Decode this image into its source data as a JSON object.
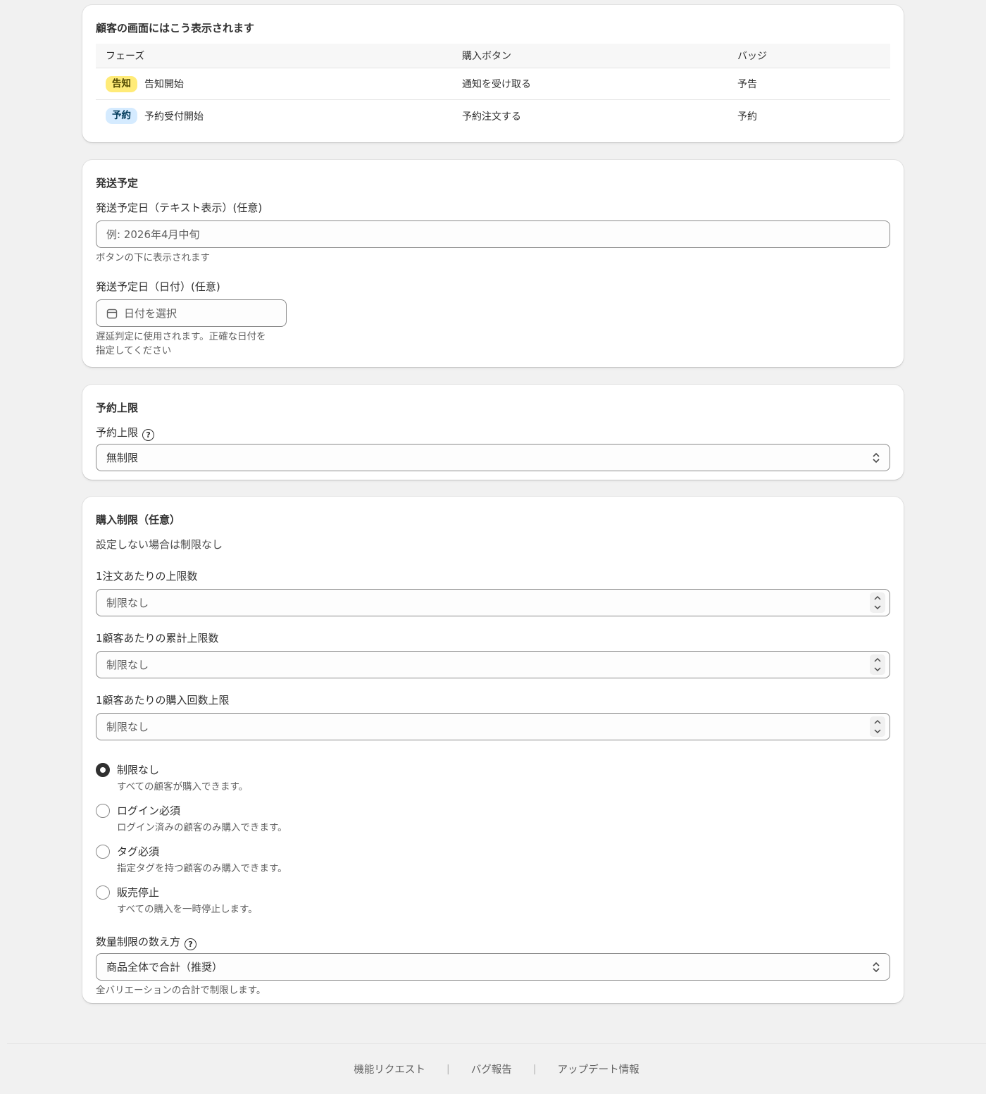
{
  "preview": {
    "title": "顧客の画面にはこう表示されます",
    "columns": [
      "フェーズ",
      "購入ボタン",
      "バッジ"
    ],
    "rows": [
      {
        "badge": "告知",
        "phase": "告知開始",
        "button": "通知を受け取る",
        "badge_text": "予告",
        "badge_color": "#ffeb78"
      },
      {
        "badge": "予約",
        "phase": "予約受付開始",
        "button": "予約注文する",
        "badge_text": "予約",
        "badge_color": "#d5ebff"
      }
    ]
  },
  "shipping": {
    "title": "発送予定",
    "text_label": "発送予定日（テキスト表示）(任意)",
    "text_placeholder": "例: 2026年4月中旬",
    "text_help": "ボタンの下に表示されます",
    "date_label": "発送予定日（日付）(任意)",
    "date_placeholder": "日付を選択",
    "date_help_line1": "遅延判定に使用されます。正確な日付を",
    "date_help_line2": "指定してください"
  },
  "limit": {
    "title": "予約上限",
    "label": "予約上限",
    "value": "無制限"
  },
  "purchase": {
    "title": "購入制限（任意）",
    "subtitle": "設定しない場合は制限なし",
    "per_order_label": "1注文あたりの上限数",
    "per_order_placeholder": "制限なし",
    "per_customer_label": "1顧客あたりの累計上限数",
    "per_customer_placeholder": "制限なし",
    "times_label": "1顧客あたりの購入回数上限",
    "times_placeholder": "制限なし",
    "radios": [
      {
        "label": "制限なし",
        "help": "すべての顧客が購入できます。",
        "checked": true
      },
      {
        "label": "ログイン必須",
        "help": "ログイン済みの顧客のみ購入できます。",
        "checked": false
      },
      {
        "label": "タグ必須",
        "help": "指定タグを持つ顧客のみ購入できます。",
        "checked": false
      },
      {
        "label": "販売停止",
        "help": "すべての購入を一時停止します。",
        "checked": false
      }
    ],
    "count_label": "数量制限の数え方",
    "count_value": "商品全体で合計（推奨）",
    "count_help": "全バリエーションの合計で制限します。"
  },
  "footer": {
    "links": [
      "機能リクエスト",
      "バグ報告",
      "アップデート情報"
    ],
    "separator": "|"
  }
}
